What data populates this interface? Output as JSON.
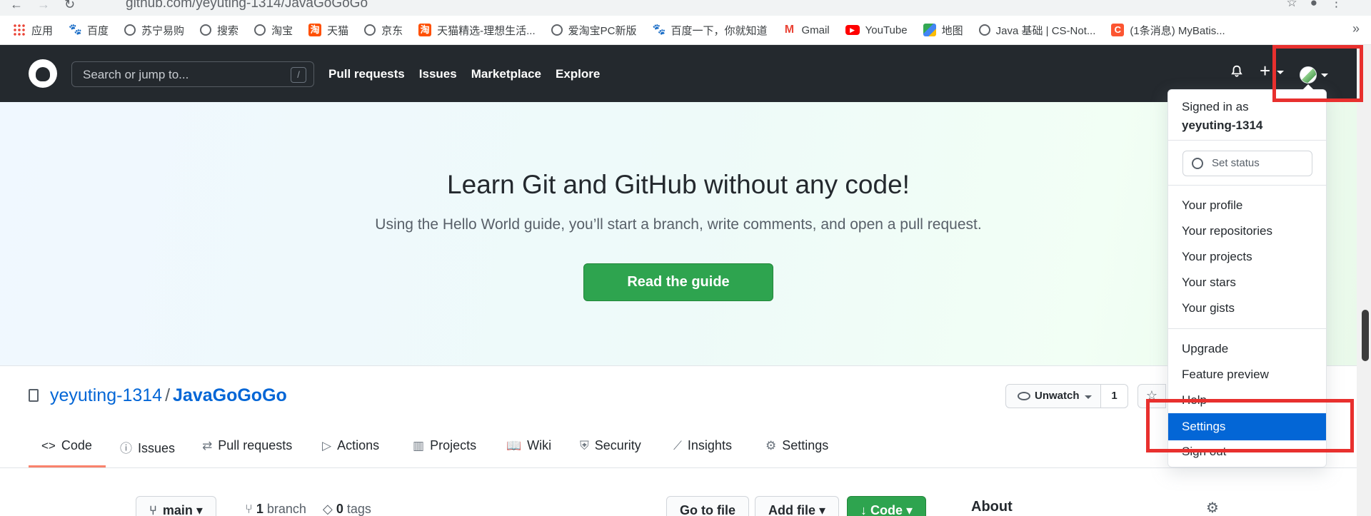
{
  "browser": {
    "url": "github.com/yeyuting-1314/JavaGoGoGo",
    "bookmarks": [
      {
        "label": "应用",
        "icon": "apps"
      },
      {
        "label": "百度",
        "icon": "baidu"
      },
      {
        "label": "苏宁易购",
        "icon": "globe"
      },
      {
        "label": "搜索",
        "icon": "globe"
      },
      {
        "label": "淘宝",
        "icon": "globe"
      },
      {
        "label": "天猫",
        "icon": "tmall"
      },
      {
        "label": "京东",
        "icon": "globe"
      },
      {
        "label": "天猫精选-理想生活...",
        "icon": "tmall"
      },
      {
        "label": "爱淘宝PC新版",
        "icon": "globe"
      },
      {
        "label": "百度一下，你就知道",
        "icon": "baidu"
      },
      {
        "label": "Gmail",
        "icon": "gmail"
      },
      {
        "label": "YouTube",
        "icon": "youtube"
      },
      {
        "label": "地图",
        "icon": "map"
      },
      {
        "label": "Java 基础 | CS-Not...",
        "icon": "globe"
      },
      {
        "label": "(1条消息) MyBatis...",
        "icon": "csdn"
      }
    ],
    "more": "»"
  },
  "header": {
    "search_placeholder": "Search or jump to...",
    "search_shortcut": "/",
    "nav": [
      "Pull requests",
      "Issues",
      "Marketplace",
      "Explore"
    ],
    "plus": "+"
  },
  "banner": {
    "title": "Learn Git and GitHub without any code!",
    "subtitle": "Using the Hello World guide, you’ll start a branch, write comments, and open a pull request.",
    "button": "Read the guide"
  },
  "repo": {
    "owner": "yeyuting-1314",
    "separator": "/",
    "name": "JavaGoGoGo",
    "watch_label": "Unwatch",
    "watch_count": "1",
    "star_icon": "☆"
  },
  "tabs": [
    {
      "label": "Code",
      "icon": "<>"
    },
    {
      "label": "Issues",
      "icon": "ⓘ"
    },
    {
      "label": "Pull requests",
      "icon": "⇄"
    },
    {
      "label": "Actions",
      "icon": "▷"
    },
    {
      "label": "Projects",
      "icon": "▥"
    },
    {
      "label": "Wiki",
      "icon": "📖"
    },
    {
      "label": "Security",
      "icon": "⛨"
    },
    {
      "label": "Insights",
      "icon": "⟋"
    },
    {
      "label": "Settings",
      "icon": "⚙"
    }
  ],
  "toolbar": {
    "branch_button": "main",
    "branch_count": "1",
    "branch_word": "branch",
    "tag_count": "0",
    "tag_word": "tags",
    "go_to_file": "Go to file",
    "add_file": "Add file",
    "code": "Code",
    "about": "About"
  },
  "dropdown": {
    "signed_in_as": "Signed in as",
    "username": "yeyuting-1314",
    "set_status": "Set status",
    "items": [
      "Your profile",
      "Your repositories",
      "Your projects",
      "Your stars",
      "Your gists"
    ],
    "items2": [
      "Upgrade",
      "Feature preview",
      "Help",
      "Settings",
      "Sign out"
    ],
    "active": "Settings"
  },
  "colors": {
    "header": "#24292e",
    "accent": "#0366d6",
    "primary": "#2ea44f",
    "highlight": "#e8302e"
  }
}
